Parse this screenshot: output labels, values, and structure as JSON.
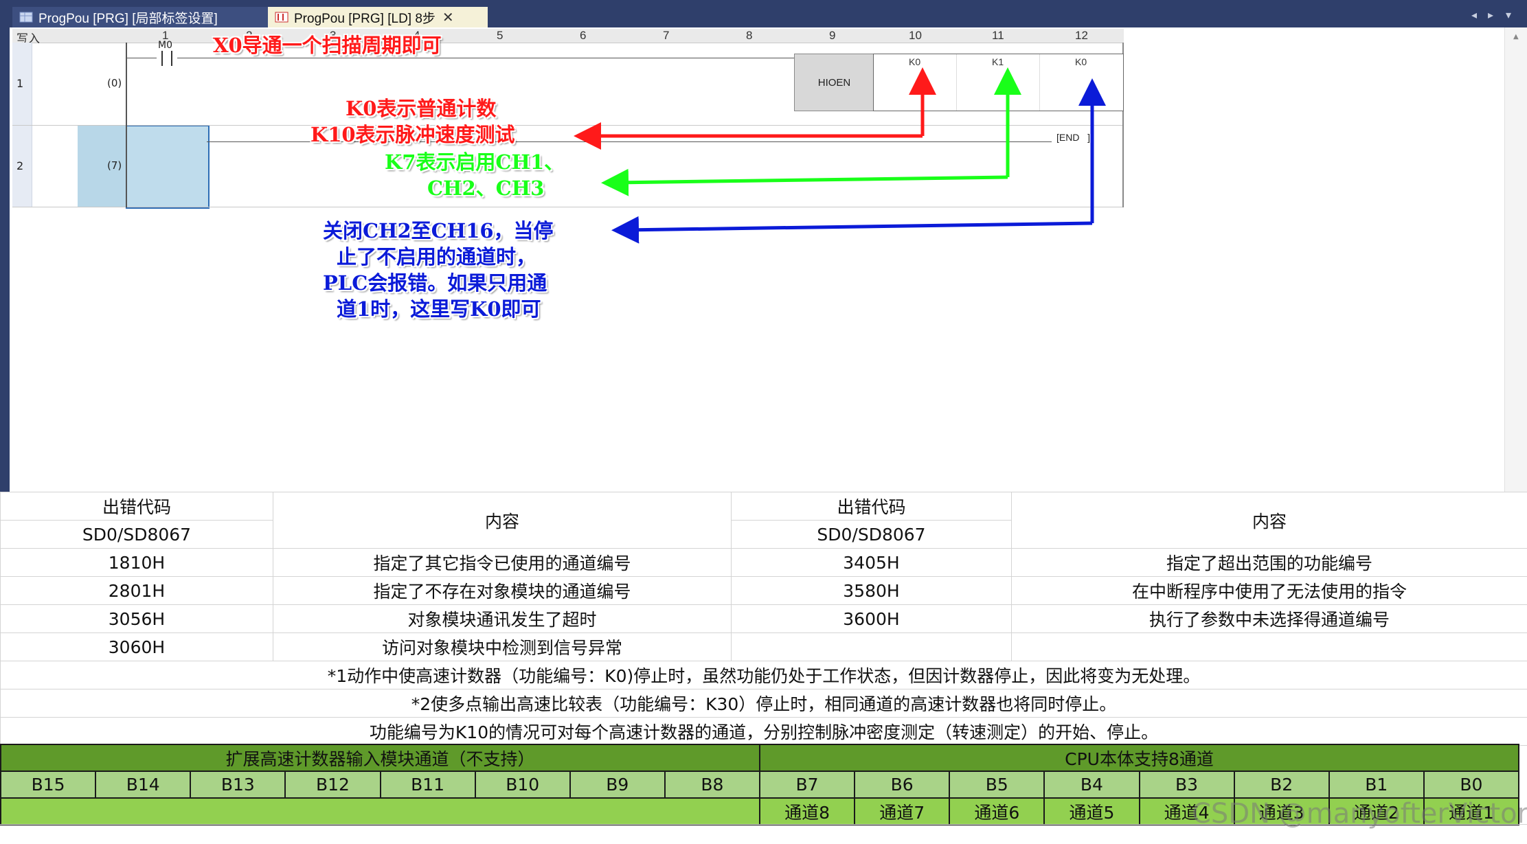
{
  "tabs": [
    {
      "label": "ProgPou [PRG] [局部标签设置]"
    },
    {
      "label": "ProgPou [PRG] [LD] 8步",
      "close": "✕"
    }
  ],
  "ladder": {
    "corner_label": "写入",
    "columns": [
      "1",
      "2",
      "3",
      "4",
      "5",
      "6",
      "7",
      "8",
      "9",
      "10",
      "11",
      "12"
    ],
    "rows": [
      {
        "row": "1",
        "step": "(0)",
        "contact": "M0"
      },
      {
        "row": "2",
        "step": "(7)"
      }
    ],
    "instruction": {
      "name": "HIOEN",
      "operands": [
        "K0",
        "K1",
        "K0"
      ]
    },
    "end_label": "END"
  },
  "annotations": {
    "x0": "X0导通一个扫描周期即可",
    "k0_line1": "K0表示普通计数",
    "k0_line2": "K10表示脉冲速度测试",
    "k7_line1": "K7表示启用CH1、",
    "k7_line2": "CH2、CH3",
    "close_line1": "关闭CH2至CH16，当停",
    "close_line2": "止了不启用的通道时，",
    "close_line3": "PLC会报错。如果只用通",
    "close_line4": "道1时，这里写K0即可"
  },
  "colors": {
    "red": "#ff1a1a",
    "green": "#19ff19",
    "blue": "#0b1bd8",
    "tab_bg": "#2f3f6b",
    "green_dark": "#5f9a2a",
    "green_mid": "#a9d388",
    "green_bright": "#92d050"
  },
  "error_table": {
    "header_code": "出错代码",
    "header_reg": "SD0/SD8067",
    "header_content": "内容",
    "rows": [
      {
        "code1": "1810H",
        "desc1": "指定了其它指令已使用的通道编号",
        "code2": "3405H",
        "desc2": "指定了超出范围的功能编号"
      },
      {
        "code1": "2801H",
        "desc1": "指定了不存在对象模块的通道编号",
        "code2": "3580H",
        "desc2": "在中断程序中使用了无法使用的指令"
      },
      {
        "code1": "3056H",
        "desc1": "对象模块通讯发生了超时",
        "code2": "3600H",
        "desc2": "执行了参数中未选择得通道编号"
      },
      {
        "code1": "3060H",
        "desc1": "访问对象模块中检测到信号异常",
        "code2": "",
        "desc2": ""
      }
    ],
    "notes": [
      "*1动作中使高速计数器（功能编号：K0)停止时，虽然功能仍处于工作状态，但因计数器停止，因此将变为无处理。",
      "*2使多点输出高速比较表（功能编号：K30）停止时，相同通道的高速计数器也将同时停止。",
      "功能编号为K10的情况可对每个高速计数器的通道，分别控制脉冲密度测定（转速测定）的开始、停止。"
    ]
  },
  "channel_table": {
    "ext_header": "扩展高速计数器输入模块通道（不支持）",
    "cpu_header": "CPU本体支持8通道",
    "bits": [
      "B15",
      "B14",
      "B13",
      "B12",
      "B11",
      "B10",
      "B9",
      "B8",
      "B7",
      "B6",
      "B5",
      "B4",
      "B3",
      "B2",
      "B1",
      "B0"
    ],
    "channels": [
      "通道8",
      "通道7",
      "通道6",
      "通道5",
      "通道4",
      "通道3",
      "通道2",
      "通道1"
    ]
  },
  "watermark": "CSDN @manyofterVictory"
}
